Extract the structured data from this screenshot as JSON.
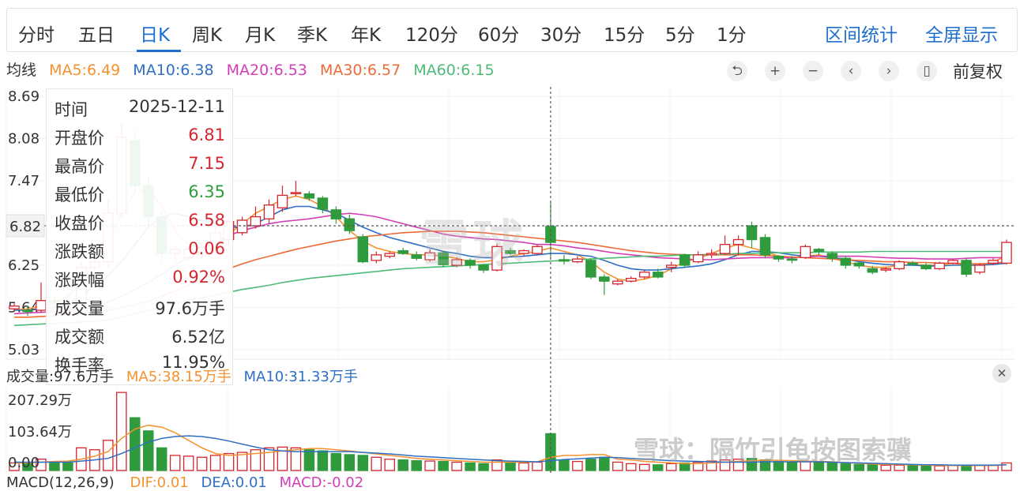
{
  "tabs": [
    "分时",
    "五日",
    "日K",
    "周K",
    "月K",
    "季K",
    "年K",
    "120分",
    "60分",
    "30分",
    "15分",
    "5分",
    "1分"
  ],
  "active_tab": "日K",
  "right_tools": {
    "interval_stats": "区间统计",
    "fullscreen": "全屏显示"
  },
  "ma_legend": {
    "title": "均线",
    "items": [
      {
        "label": "MA5:6.49",
        "color": "#f5922f"
      },
      {
        "label": "MA10:6.38",
        "color": "#2f6fc4"
      },
      {
        "label": "MA20:6.53",
        "color": "#d23fb5"
      },
      {
        "label": "MA30:6.57",
        "color": "#ee6a37"
      },
      {
        "label": "MA60:6.15",
        "color": "#4dbb76"
      }
    ]
  },
  "controls": {
    "undo": "⮌",
    "plus": "+",
    "minus": "−",
    "prev": "‹",
    "next": "›",
    "candle": "▯",
    "adjust": "前复权"
  },
  "y_axis": [
    "8.69",
    "8.08",
    "7.47",
    "6.82",
    "6.25",
    "5.64",
    "5.03"
  ],
  "tooltip": {
    "rows": [
      {
        "k": "时间",
        "v": "2025-12-11",
        "tone": "dark"
      },
      {
        "k": "开盘价",
        "v": "6.81",
        "tone": "red"
      },
      {
        "k": "最高价",
        "v": "7.15",
        "tone": "red"
      },
      {
        "k": "最低价",
        "v": "6.35",
        "tone": "green"
      },
      {
        "k": "收盘价",
        "v": "6.58",
        "tone": "red"
      },
      {
        "k": "涨跌额",
        "v": "0.06",
        "tone": "red"
      },
      {
        "k": "涨跌幅",
        "v": "0.92%",
        "tone": "red"
      },
      {
        "k": "成交量",
        "v": "97.6万手",
        "tone": "dark"
      },
      {
        "k": "成交额",
        "v": "6.52亿",
        "tone": "dark"
      },
      {
        "k": "换手率",
        "v": "11.95%",
        "tone": "dark"
      }
    ]
  },
  "volume": {
    "legend_vol": "成交量:97.6万手",
    "legend_ma5": "MA5:38.15万手",
    "legend_ma10": "MA10:31.33万手",
    "y_axis": [
      "207.29万",
      "103.64万",
      "0.00"
    ],
    "close": "✕"
  },
  "macd_legend": {
    "title": "MACD(12,26,9)",
    "dif": "DIF:0.01",
    "dea": "DEA:0.01",
    "macd": "MACD:-0.02"
  },
  "watermark": {
    "big": "雪球",
    "bottom": "雪球：隔竹引龟按图索骥"
  },
  "colors": {
    "up": "#d4262f",
    "down": "#2f9b3d",
    "accent": "#1f6fd0"
  },
  "crosshair_price": "6.82",
  "chart_data": {
    "type": "candlestick",
    "ylim": [
      5.03,
      8.69
    ],
    "candles": [
      [
        5.62,
        5.66,
        5.58,
        5.7
      ],
      [
        5.6,
        5.58,
        5.52,
        5.66
      ],
      [
        5.6,
        5.74,
        5.56,
        6.0
      ],
      [
        5.74,
        5.72,
        5.66,
        5.8
      ],
      [
        5.72,
        5.7,
        5.62,
        5.78
      ],
      [
        5.7,
        6.22,
        5.68,
        6.3
      ],
      [
        6.22,
        6.3,
        6.1,
        6.44
      ],
      [
        6.3,
        7.0,
        6.2,
        7.2
      ],
      [
        7.0,
        8.1,
        6.95,
        8.3
      ],
      [
        8.05,
        7.4,
        7.3,
        8.2
      ],
      [
        7.4,
        6.95,
        6.8,
        7.55
      ],
      [
        6.95,
        6.42,
        6.3,
        7.05
      ],
      [
        6.42,
        6.48,
        6.3,
        6.52
      ],
      [
        6.36,
        6.48,
        6.33,
        6.52
      ],
      [
        6.4,
        6.5,
        6.35,
        6.55
      ],
      [
        6.45,
        6.72,
        6.4,
        6.8
      ],
      [
        6.62,
        6.88,
        6.55,
        6.95
      ],
      [
        6.72,
        6.9,
        6.68,
        6.95
      ],
      [
        6.82,
        6.95,
        6.78,
        7.1
      ],
      [
        6.92,
        7.12,
        6.85,
        7.2
      ],
      [
        7.08,
        7.26,
        7.02,
        7.4
      ],
      [
        7.3,
        7.3,
        7.25,
        7.47
      ],
      [
        7.28,
        7.22,
        7.18,
        7.32
      ],
      [
        7.22,
        7.06,
        7.0,
        7.25
      ],
      [
        7.05,
        6.92,
        6.85,
        7.1
      ],
      [
        6.92,
        6.75,
        6.7,
        6.98
      ],
      [
        6.66,
        6.3,
        6.28,
        6.7
      ],
      [
        6.32,
        6.4,
        6.28,
        6.45
      ],
      [
        6.38,
        6.42,
        6.35,
        6.45
      ],
      [
        6.46,
        6.42,
        6.4,
        6.5
      ],
      [
        6.4,
        6.35,
        6.32,
        6.45
      ],
      [
        6.33,
        6.43,
        6.3,
        6.48
      ],
      [
        6.43,
        6.26,
        6.22,
        6.46
      ],
      [
        6.25,
        6.33,
        6.22,
        6.36
      ],
      [
        6.32,
        6.25,
        6.2,
        6.35
      ],
      [
        6.25,
        6.18,
        6.14,
        6.27
      ],
      [
        6.18,
        6.52,
        6.16,
        6.56
      ],
      [
        6.46,
        6.42,
        6.4,
        6.5
      ],
      [
        6.42,
        6.46,
        6.38,
        6.48
      ],
      [
        6.42,
        6.52,
        6.4,
        6.55
      ],
      [
        6.81,
        6.58,
        6.35,
        7.15
      ],
      [
        6.33,
        6.31,
        6.26,
        6.4
      ],
      [
        6.3,
        6.34,
        6.28,
        6.38
      ],
      [
        6.32,
        6.08,
        6.05,
        6.35
      ],
      [
        6.08,
        6.02,
        5.82,
        6.12
      ],
      [
        5.98,
        6.02,
        5.96,
        6.05
      ],
      [
        6.02,
        6.06,
        6.0,
        6.09
      ],
      [
        6.08,
        6.15,
        6.05,
        6.18
      ],
      [
        6.15,
        6.08,
        6.06,
        6.2
      ],
      [
        6.22,
        6.25,
        6.15,
        6.3
      ],
      [
        6.4,
        6.25,
        6.22,
        6.42
      ],
      [
        6.3,
        6.4,
        6.28,
        6.45
      ],
      [
        6.4,
        6.42,
        6.35,
        6.48
      ],
      [
        6.42,
        6.55,
        6.4,
        6.68
      ],
      [
        6.55,
        6.62,
        6.4,
        6.68
      ],
      [
        6.82,
        6.62,
        6.5,
        6.88
      ],
      [
        6.65,
        6.4,
        6.35,
        6.7
      ],
      [
        6.38,
        6.34,
        6.3,
        6.4
      ],
      [
        6.34,
        6.33,
        6.28,
        6.38
      ],
      [
        6.36,
        6.52,
        6.34,
        6.55
      ],
      [
        6.48,
        6.45,
        6.4,
        6.5
      ],
      [
        6.42,
        6.35,
        6.3,
        6.45
      ],
      [
        6.35,
        6.25,
        6.2,
        6.38
      ],
      [
        6.28,
        6.24,
        6.2,
        6.3
      ],
      [
        6.2,
        6.15,
        6.12,
        6.24
      ],
      [
        6.18,
        6.2,
        6.15,
        6.22
      ],
      [
        6.2,
        6.3,
        6.18,
        6.32
      ],
      [
        6.28,
        6.27,
        6.24,
        6.31
      ],
      [
        6.25,
        6.2,
        6.18,
        6.28
      ],
      [
        6.2,
        6.28,
        6.18,
        6.3
      ],
      [
        6.28,
        6.32,
        6.26,
        6.34
      ],
      [
        6.32,
        6.12,
        6.08,
        6.35
      ],
      [
        6.15,
        6.25,
        6.12,
        6.28
      ],
      [
        6.28,
        6.32,
        6.25,
        6.35
      ],
      [
        6.28,
        6.58,
        6.26,
        6.62
      ]
    ],
    "ma_series": [
      {
        "name": "MA5",
        "values": [
          5.6,
          5.62,
          5.66,
          5.7,
          5.8,
          6.0,
          6.3,
          6.6,
          7.0,
          7.3,
          7.35,
          7.1,
          6.75,
          6.55,
          6.5,
          6.55,
          6.7,
          6.85,
          7.0,
          7.1,
          7.2,
          7.25,
          7.2,
          7.1,
          6.95,
          6.75,
          6.6,
          6.5,
          6.45,
          6.42,
          6.4,
          6.4,
          6.38,
          6.35,
          6.3,
          6.3,
          6.33,
          6.38,
          6.42,
          6.45,
          6.5,
          6.45,
          6.4,
          6.3,
          6.15,
          6.05,
          6.02,
          6.05,
          6.1,
          6.2,
          6.3,
          6.35,
          6.42,
          6.5,
          6.55,
          6.5,
          6.45,
          6.38,
          6.36,
          6.38,
          6.4,
          6.35,
          6.3,
          6.25,
          6.22,
          6.22,
          6.25,
          6.26,
          6.25,
          6.25,
          6.28,
          6.25,
          6.25,
          6.3,
          6.38
        ]
      },
      {
        "name": "MA10",
        "values": [
          5.6,
          5.6,
          5.62,
          5.64,
          5.7,
          5.8,
          5.95,
          6.1,
          6.3,
          6.55,
          6.8,
          6.95,
          7.0,
          6.95,
          6.9,
          6.85,
          6.8,
          6.8,
          6.85,
          6.95,
          7.05,
          7.1,
          7.1,
          7.05,
          7.0,
          6.9,
          6.8,
          6.72,
          6.65,
          6.6,
          6.55,
          6.5,
          6.45,
          6.42,
          6.38,
          6.36,
          6.36,
          6.37,
          6.38,
          6.4,
          6.42,
          6.42,
          6.4,
          6.38,
          6.32,
          6.25,
          6.2,
          6.18,
          6.18,
          6.2,
          6.22,
          6.24,
          6.27,
          6.33,
          6.4,
          6.45,
          6.45,
          6.43,
          6.4,
          6.38,
          6.38,
          6.36,
          6.34,
          6.3,
          6.28,
          6.26,
          6.25,
          6.25,
          6.24,
          6.24,
          6.25,
          6.25,
          6.25,
          6.26,
          6.28
        ]
      },
      {
        "name": "MA20",
        "values": [
          5.55,
          5.56,
          5.57,
          5.58,
          5.6,
          5.62,
          5.66,
          5.72,
          5.8,
          5.9,
          6.0,
          6.12,
          6.25,
          6.38,
          6.5,
          6.6,
          6.68,
          6.75,
          6.8,
          6.85,
          6.88,
          6.9,
          6.92,
          6.95,
          6.98,
          7.0,
          6.98,
          6.95,
          6.9,
          6.85,
          6.8,
          6.75,
          6.7,
          6.67,
          6.65,
          6.63,
          6.62,
          6.6,
          6.58,
          6.55,
          6.55,
          6.53,
          6.5,
          6.48,
          6.45,
          6.42,
          6.4,
          6.38,
          6.36,
          6.35,
          6.34,
          6.33,
          6.33,
          6.34,
          6.35,
          6.36,
          6.36,
          6.36,
          6.36,
          6.37,
          6.38,
          6.38,
          6.38,
          6.38,
          6.37,
          6.36,
          6.35,
          6.35,
          6.34,
          6.34,
          6.34,
          6.35,
          6.36,
          6.36,
          6.36
        ]
      },
      {
        "name": "MA30",
        "values": [
          5.5,
          5.5,
          5.51,
          5.52,
          5.53,
          5.55,
          5.57,
          5.6,
          5.64,
          5.68,
          5.73,
          5.8,
          5.88,
          5.96,
          6.05,
          6.13,
          6.2,
          6.27,
          6.33,
          6.38,
          6.43,
          6.48,
          6.52,
          6.56,
          6.6,
          6.63,
          6.66,
          6.68,
          6.7,
          6.72,
          6.73,
          6.74,
          6.74,
          6.74,
          6.73,
          6.72,
          6.7,
          6.68,
          6.66,
          6.64,
          6.62,
          6.6,
          6.58,
          6.55,
          6.52,
          6.49,
          6.46,
          6.44,
          6.42,
          6.41,
          6.4,
          6.4,
          6.4,
          6.4,
          6.4,
          6.4,
          6.39,
          6.38,
          6.37,
          6.36,
          6.35,
          6.34,
          6.33,
          6.32,
          6.31,
          6.3,
          6.3,
          6.29,
          6.29,
          6.28,
          6.28,
          6.27,
          6.27,
          6.28,
          6.3
        ]
      },
      {
        "name": "MA60",
        "values": [
          5.38,
          5.39,
          5.4,
          5.41,
          5.42,
          5.43,
          5.44,
          5.46,
          5.5,
          5.55,
          5.6,
          5.65,
          5.7,
          5.74,
          5.78,
          5.82,
          5.86,
          5.9,
          5.93,
          5.96,
          6.0,
          6.03,
          6.06,
          6.08,
          6.1,
          6.12,
          6.14,
          6.16,
          6.18,
          6.2,
          6.21,
          6.22,
          6.23,
          6.24,
          6.25,
          6.26,
          6.27,
          6.28,
          6.29,
          6.3,
          6.31,
          6.32,
          6.33,
          6.34,
          6.35,
          6.36,
          6.37,
          6.38,
          6.38,
          6.39,
          6.4,
          6.4,
          6.41,
          6.41,
          6.42,
          6.42,
          6.43,
          6.43,
          6.43,
          6.43,
          6.44,
          6.44,
          6.44,
          6.44,
          6.45,
          6.45,
          6.45,
          6.45,
          6.45,
          6.45,
          6.45,
          6.45,
          6.45,
          6.45,
          6.45
        ]
      }
    ],
    "volume_values": [
      20,
      18,
      30,
      22,
      20,
      60,
      55,
      80,
      207,
      140,
      105,
      60,
      40,
      38,
      35,
      40,
      45,
      48,
      55,
      60,
      62,
      60,
      55,
      52,
      45,
      42,
      40,
      35,
      30,
      28,
      26,
      25,
      24,
      22,
      20,
      18,
      28,
      22,
      20,
      22,
      97.6,
      28,
      24,
      30,
      35,
      22,
      18,
      16,
      15,
      18,
      20,
      22,
      25,
      28,
      30,
      32,
      28,
      24,
      22,
      24,
      22,
      20,
      18,
      16,
      15,
      14,
      14,
      13,
      12,
      12,
      13,
      14,
      13,
      14,
      20
    ],
    "volume_ma5": [
      20,
      20,
      22,
      24,
      25,
      30,
      38,
      50,
      85,
      110,
      120,
      115,
      100,
      80,
      60,
      45,
      40,
      42,
      45,
      48,
      52,
      55,
      58,
      58,
      55,
      52,
      48,
      44,
      40,
      36,
      32,
      30,
      28,
      26,
      24,
      22,
      22,
      22,
      22,
      23,
      35,
      40,
      40,
      42,
      42,
      30,
      28,
      24,
      22,
      20,
      18,
      18,
      20,
      22,
      24,
      26,
      27,
      27,
      26,
      25,
      24,
      23,
      21,
      19,
      17,
      16,
      15,
      15,
      14,
      13,
      13,
      13,
      13,
      13,
      15
    ],
    "volume_ma10": [
      22,
      22,
      22,
      22,
      22,
      25,
      28,
      32,
      45,
      60,
      75,
      85,
      90,
      92,
      90,
      85,
      78,
      70,
      62,
      55,
      52,
      50,
      50,
      50,
      50,
      50,
      48,
      46,
      44,
      41,
      38,
      36,
      34,
      32,
      30,
      28,
      26,
      25,
      24,
      23,
      26,
      29,
      31,
      33,
      35,
      34,
      32,
      30,
      28,
      26,
      25,
      24,
      23,
      22,
      22,
      22,
      23,
      23,
      23,
      23,
      23,
      22,
      21,
      20,
      19,
      18,
      17,
      16,
      15,
      15,
      14,
      14,
      14,
      14,
      15
    ]
  }
}
